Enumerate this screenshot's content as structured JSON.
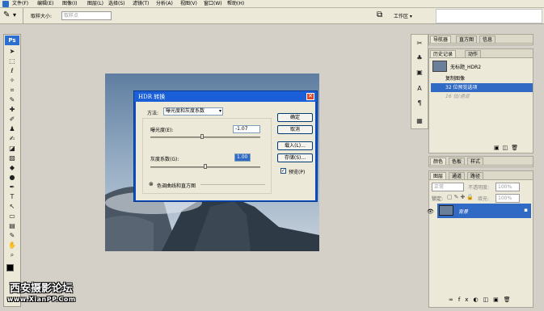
{
  "menubar": {
    "items": [
      {
        "label": "文件(F)"
      },
      {
        "label": "编辑(E)"
      },
      {
        "label": "图像(I)"
      },
      {
        "label": "图层(L)"
      },
      {
        "label": "选择(S)"
      },
      {
        "label": "滤镜(T)"
      },
      {
        "label": "分析(A)"
      },
      {
        "label": "视图(V)"
      },
      {
        "label": "窗口(W)"
      },
      {
        "label": "帮助(H)"
      }
    ]
  },
  "options": {
    "sample_size_label": "取样大小:",
    "sample_size_value": "取样点",
    "workspace_label": "工作区 ▾"
  },
  "toolbox": {
    "ps_label": "Ps"
  },
  "dialog": {
    "title": "HDR 转换",
    "method_label": "方法:",
    "method_value": "曝光度和灰度系数",
    "exposure_label": "曝光度(E):",
    "exposure_value": "-1.07",
    "exposure_fraction": 0.47,
    "gamma_label": "灰度系数(G):",
    "gamma_value": "1.00",
    "gamma_fraction": 0.5,
    "histogram_label": "色调曲线和直方图",
    "buttons": {
      "ok": "确定",
      "cancel": "取消",
      "load": "载入(L)...",
      "save": "存储(S)..."
    },
    "preview_label": "预览(P)",
    "preview_checked": true
  },
  "panels": {
    "nav_tabs": [
      "导航器",
      "直方图",
      "信息"
    ],
    "history_tabs": [
      "历史记录",
      "动作"
    ],
    "history_doc": "无标题_HDR2",
    "history_items": [
      "复制图像",
      "32 位预览选项",
      "16 位/通道"
    ],
    "color_tabs": [
      "颜色",
      "色板",
      "样式"
    ],
    "layers_tabs": [
      "图层",
      "通道",
      "路径"
    ],
    "blend_mode": "正常",
    "opacity_label": "不透明度:",
    "opacity_value": "100%",
    "lock_label": "锁定:",
    "fill_label": "填充:",
    "fill_value": "100%",
    "layer_name": "背景"
  },
  "watermark": {
    "line1": "西安摄影论坛",
    "line2": "www.XianPP.Com"
  },
  "colors": {
    "accent": "#316ac5",
    "dialog_title": "#1a5fd8",
    "workspace": "#c0c0c0"
  }
}
